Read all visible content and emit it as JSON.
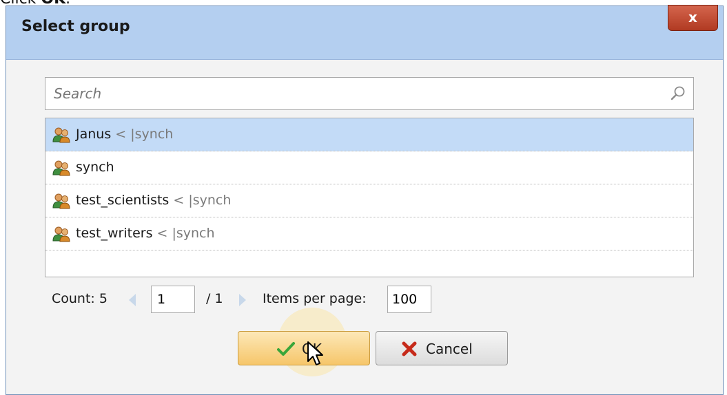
{
  "instruction": {
    "prefix": "Click ",
    "target": "OK",
    "suffix": "."
  },
  "dialog": {
    "title": "Select group",
    "close_label": "x"
  },
  "search": {
    "placeholder": "Search",
    "value": ""
  },
  "groups": [
    {
      "name": "Janus",
      "suffix": " < |synch",
      "selected": true
    },
    {
      "name": "synch",
      "suffix": "",
      "selected": false
    },
    {
      "name": "test_scientists",
      "suffix": " < |synch",
      "selected": false
    },
    {
      "name": "test_writers",
      "suffix": " < |synch",
      "selected": false
    }
  ],
  "pager": {
    "count_label": "Count: 5",
    "page": "1",
    "total": "/ 1",
    "items_per_page_label": "Items per page:",
    "items_per_page": "100"
  },
  "buttons": {
    "ok": "OK",
    "cancel": "Cancel"
  },
  "colors": {
    "titlebar": "#b4cff0",
    "selected_row": "#c3dbf7",
    "close_button": "#c24a30",
    "ok_button": "#f6c66a"
  },
  "icons": [
    "search-icon",
    "group-icon",
    "close-icon",
    "checkmark-icon",
    "cancel-x-icon",
    "prev-page-icon",
    "next-page-icon",
    "mouse-cursor-icon"
  ]
}
